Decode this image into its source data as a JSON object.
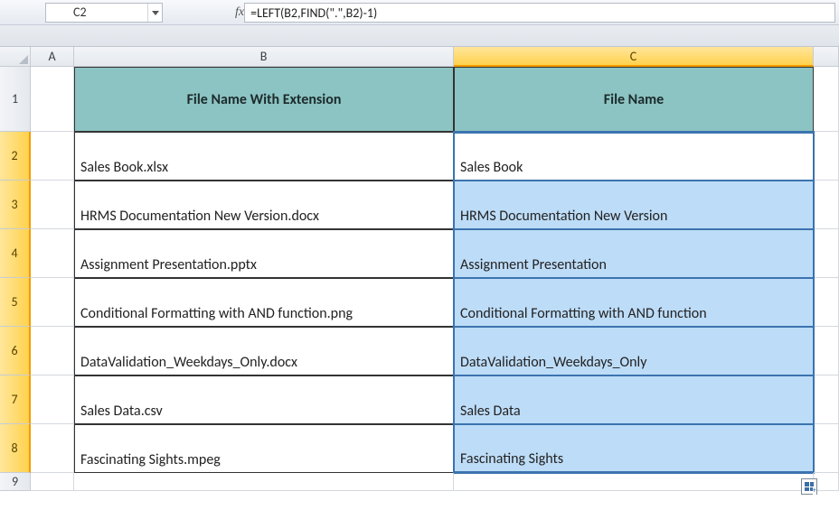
{
  "cell_ref": "C2",
  "formula": "=LEFT(B2,FIND(\".\",B2)-1)",
  "fx_label": "fx",
  "cols": {
    "A": "A",
    "B": "B",
    "C": "C"
  },
  "rownums": [
    "1",
    "2",
    "3",
    "4",
    "5",
    "6",
    "7",
    "8",
    "9"
  ],
  "headers": {
    "B": "File Name With Extension",
    "C": "File Name"
  },
  "rows": [
    {
      "b": "Sales Book.xlsx",
      "c": "Sales Book"
    },
    {
      "b": "HRMS Documentation New Version.docx",
      "c": "HRMS Documentation New Version"
    },
    {
      "b": "Assignment Presentation.pptx",
      "c": "Assignment Presentation"
    },
    {
      "b": "Conditional Formatting with AND function.png",
      "c": "Conditional Formatting with AND function"
    },
    {
      "b": "DataValidation_Weekdays_Only.docx",
      "c": "DataValidation_Weekdays_Only"
    },
    {
      "b": "Sales Data.csv",
      "c": "Sales Data"
    },
    {
      "b": "Fascinating Sights.mpeg",
      "c": "Fascinating Sights"
    }
  ]
}
